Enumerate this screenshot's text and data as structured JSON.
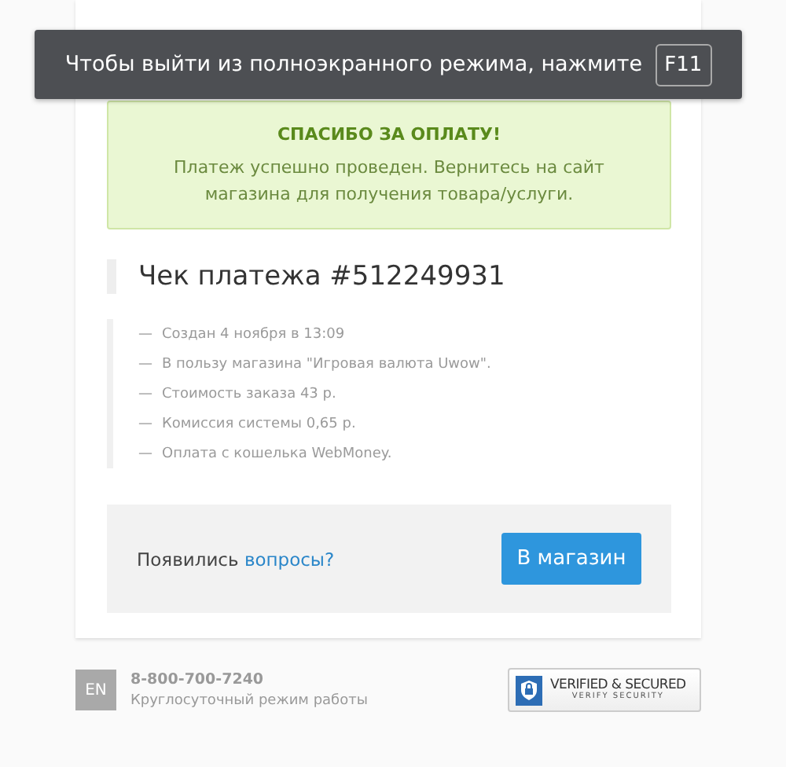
{
  "fullscreen_notice": {
    "text": "Чтобы выйти из полноэкранного режима, нажмите",
    "key": "F11"
  },
  "success": {
    "title": "СПАСИБО ЗА ОПЛАТУ!",
    "message": "Платеж успешно проведен. Вернитесь на сайт магазина для получения товара/услуги."
  },
  "receipt": {
    "title": "Чек платежа #512249931",
    "details": [
      {
        "dash": "—",
        "text": "Создан 4 ноября в 13:09"
      },
      {
        "dash": "—",
        "text": "В пользу магазина \"Игровая валюта Uwow\"."
      },
      {
        "dash": "—",
        "text": "Стоимость заказа 43 р."
      },
      {
        "dash": "—",
        "text": "Комиссия системы 0,65 р."
      },
      {
        "dash": "—",
        "text": "Оплата с кошелька WebMoney."
      }
    ]
  },
  "help": {
    "text": "Появились",
    "link": "вопросы?",
    "button": "В магазин"
  },
  "footer": {
    "language": "EN",
    "phone": "8-800-700-7240",
    "hours": "Круглосуточный режим работы",
    "badge_title": "VERIFIED & SECURED",
    "badge_subtitle": "VERIFY SECURITY"
  }
}
